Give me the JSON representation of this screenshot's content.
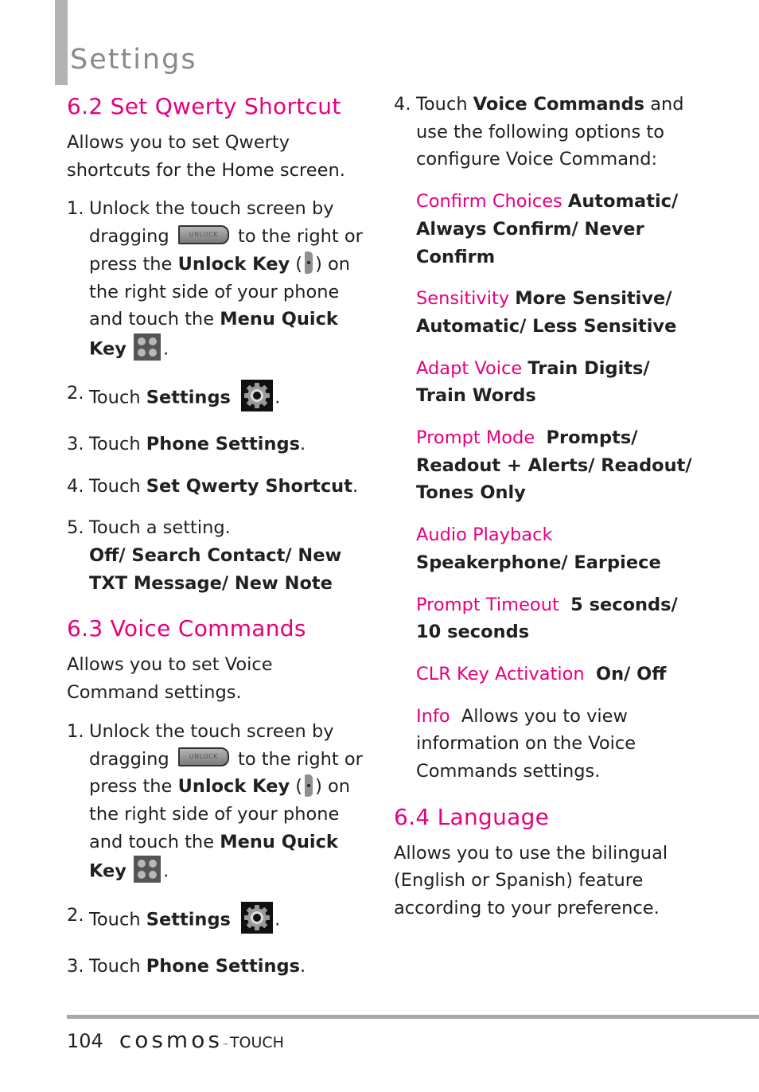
{
  "header": {
    "title": "Settings"
  },
  "sections": {
    "qwerty": {
      "heading": "6.2 Set Qwerty Shortcut",
      "intro": "Allows you to set Qwerty shortcuts for the Home screen.",
      "steps": {
        "s1": {
          "num": "1.",
          "t1": "Unlock the touch screen by dragging",
          "t2": "to the right or press the",
          "b1": "Unlock Key",
          "t3": "(",
          "t4": ") on the right side of your phone and touch the",
          "b2": "Menu Quick Key",
          "t5": "."
        },
        "s2": {
          "num": "2.",
          "t1": "Touch",
          "b1": "Settings",
          "t2": "."
        },
        "s3": {
          "num": "3.",
          "t1": "Touch",
          "b1": "Phone Settings",
          "t2": "."
        },
        "s4": {
          "num": "4.",
          "t1": "Touch",
          "b1": "Set Qwerty Shortcut",
          "t2": "."
        },
        "s5": {
          "num": "5.",
          "t1": "Touch a setting.",
          "b1": "Off/ Search Contact/ New TXT Message/ New Note"
        }
      }
    },
    "voice": {
      "heading": "6.3 Voice Commands",
      "intro": "Allows you to set Voice Command settings.",
      "steps": {
        "s1": {
          "num": "1.",
          "t1": "Unlock the touch screen by dragging",
          "t2": "to the right or press the",
          "b1": "Unlock Key",
          "t3": "(",
          "t4": ") on the right side of your phone and touch the",
          "b2": "Menu Quick Key",
          "t5": "."
        },
        "s2": {
          "num": "2.",
          "t1": "Touch",
          "b1": "Settings",
          "t2": "."
        },
        "s3": {
          "num": "3.",
          "t1": "Touch",
          "b1": "Phone Settings",
          "t2": "."
        },
        "s4": {
          "num": "4.",
          "t1": "Touch",
          "b1": "Voice Commands",
          "t2": "and use the following options to configure Voice Command:"
        }
      },
      "options": [
        {
          "label": "Confirm Choices",
          "value": "Automatic/ Always Confirm/ Never Confirm"
        },
        {
          "label": "Sensitivity",
          "value": "More Sensitive/ Automatic/ Less Sensitive"
        },
        {
          "label": "Adapt Voice",
          "value": "Train Digits/ Train Words"
        },
        {
          "label": "Prompt Mode",
          "value": "Prompts/ Readout + Alerts/ Readout/ Tones Only"
        },
        {
          "label": "Audio Playback",
          "value": "Speakerphone/ Earpiece"
        },
        {
          "label": "Prompt Timeout",
          "value": "5 seconds/ 10 seconds"
        },
        {
          "label": "CLR Key Activation",
          "value": "On/ Off"
        },
        {
          "label": "Info",
          "value": "Allows you to view information on the Voice Commands settings."
        }
      ]
    },
    "language": {
      "heading": "6.4 Language",
      "intro": "Allows you to use the bilingual (English or Spanish) feature according to your preference."
    }
  },
  "icons": {
    "unlock_slider_text": "UNLOCK"
  },
  "footer": {
    "page_number": "104",
    "brand": "cosmos",
    "trademark": "™",
    "brand_suffix": "TOUCH"
  },
  "colors": {
    "accent": "#e6007e",
    "title_gray": "#8a8a8a",
    "rule_gray": "#a8a8a8"
  }
}
